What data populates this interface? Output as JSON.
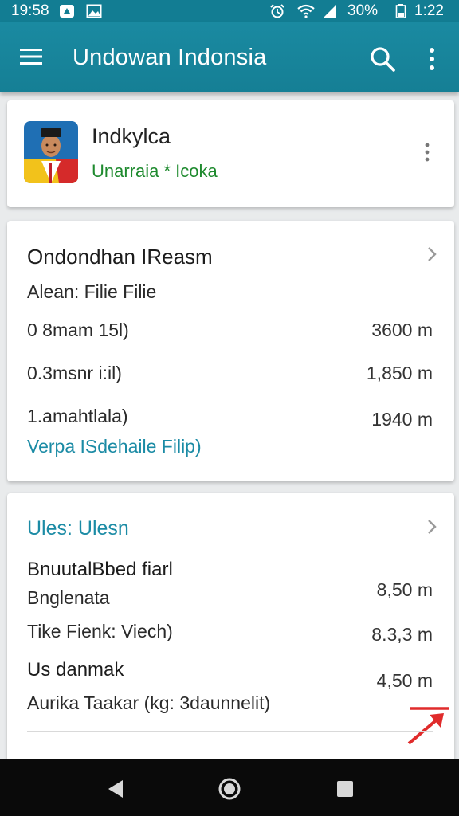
{
  "status_bar": {
    "time": "19:58",
    "battery": "30%",
    "clock": "1:22"
  },
  "app_bar": {
    "title": "Undowan Indonsia"
  },
  "profile": {
    "name": "Indkylca",
    "subtitle": "Unarraia * Icoka"
  },
  "section1": {
    "heading": "Ondondhan IReasm",
    "subheading": "Alean: Filie Filie",
    "rows": [
      {
        "label": "0 8mam 15l)",
        "value": "3600 m"
      },
      {
        "label": "0.3msnr i:il)",
        "value": "1,850 m"
      },
      {
        "label": "1.amahtlala)",
        "value": "1940 m"
      }
    ],
    "link": "Verpa ISdehaile Filip)"
  },
  "section2": {
    "heading": "Ules: Ulesn",
    "group1_title": "BnuutalBbed fiarl",
    "rows": [
      {
        "label": "Bnglenata",
        "value": "8,50 m"
      },
      {
        "label": "Tike Fienk: Viech)",
        "value": "8.3,3 m"
      }
    ],
    "group2_title": "Us danmak",
    "group2_value": "4,50 m",
    "group2_sub": "Aurika Taakar (kg: 3daunnelit)"
  },
  "colors": {
    "primary": "#157f95",
    "accent_link": "#1b8ba5",
    "accent_green": "#1e8a2e",
    "arrow_red": "#e02b2b"
  },
  "icons": [
    "menu-icon",
    "search-icon",
    "more-vert-icon",
    "chevron-right-icon",
    "arrow-up-right-icon",
    "back-icon",
    "home-icon",
    "recents-icon"
  ]
}
